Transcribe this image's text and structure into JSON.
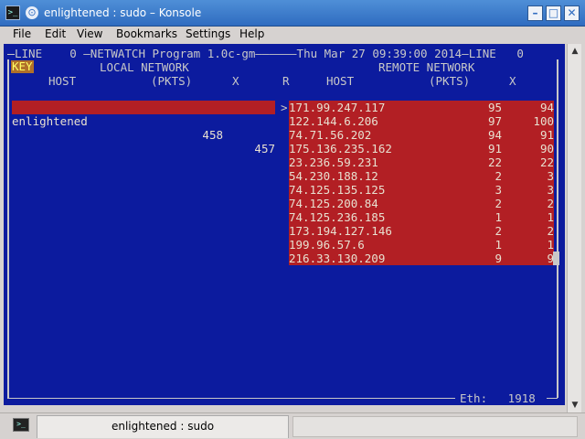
{
  "window": {
    "title": "enlightened : sudo – Konsole",
    "controls": {
      "minimize": "–",
      "maximize": "□",
      "close": "✕"
    },
    "icon": "terminal-icon"
  },
  "menubar": {
    "items": [
      "File",
      "Edit",
      "View",
      "Bookmarks",
      "Settings",
      "Help"
    ]
  },
  "terminal": {
    "header_line": "LINE    0 —NETWATCH Program 1.0c-gm——————Thu Mar 27 09:39:00 2014—LINE   0",
    "key_label": "KEY",
    "local_network_label": "LOCAL NETWORK",
    "remote_network_label": "REMOTE NETWORK",
    "local_cols": {
      "host": "HOST",
      "pkts": "(PKTS)",
      "x": "X",
      "r": "R"
    },
    "remote_cols": {
      "host": "HOST",
      "pkts": "(PKTS)",
      "x": "X"
    },
    "local_host": {
      "name": "enlightened",
      "pkts": "458",
      "x": "457"
    },
    "arrow": ">",
    "remote_hosts": [
      {
        "host": "171.99.247.117",
        "pkts": "95",
        "x": "94"
      },
      {
        "host": "122.144.6.206",
        "pkts": "97",
        "x": "100"
      },
      {
        "host": "74.71.56.202",
        "pkts": "94",
        "x": "91"
      },
      {
        "host": "175.136.235.162",
        "pkts": "91",
        "x": "90"
      },
      {
        "host": "23.236.59.231",
        "pkts": "22",
        "x": "22"
      },
      {
        "host": "54.230.188.12",
        "pkts": "2",
        "x": "3"
      },
      {
        "host": "74.125.135.125",
        "pkts": "3",
        "x": "3"
      },
      {
        "host": "74.125.200.84",
        "pkts": "2",
        "x": "2"
      },
      {
        "host": "74.125.236.185",
        "pkts": "1",
        "x": "1"
      },
      {
        "host": "173.194.127.146",
        "pkts": "2",
        "x": "2"
      },
      {
        "host": "199.96.57.6",
        "pkts": "1",
        "x": "1"
      },
      {
        "host": "216.33.130.209",
        "pkts": "9",
        "x": "9"
      }
    ],
    "footer": "Eth:   1918"
  },
  "tabbar": {
    "tab_label": "enlightened : sudo"
  },
  "colors": {
    "terminal_bg": "#0c1b9e",
    "highlight_bg": "#b21f24",
    "titlebar": "#3b7ccb"
  }
}
